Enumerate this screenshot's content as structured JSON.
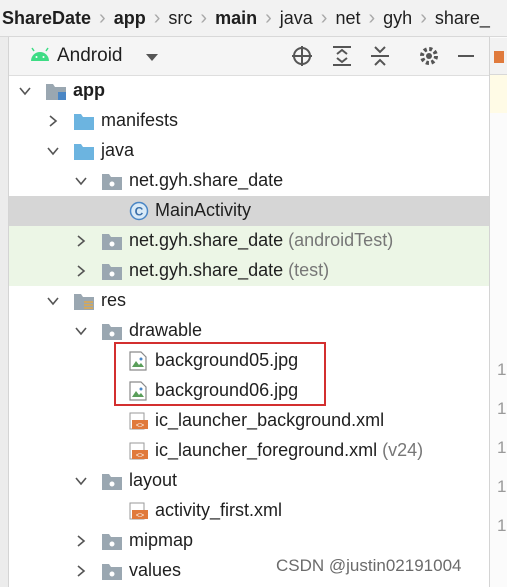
{
  "breadcrumb": {
    "items": [
      "ShareDate",
      "app",
      "src",
      "main",
      "java",
      "net",
      "gyh",
      "share_"
    ]
  },
  "toolbar": {
    "view_label": "Android",
    "dropdown_icon": "triangle-down-icon",
    "icons": [
      "locate-icon",
      "expand-all-icon",
      "collapse-all-icon",
      "gear-icon",
      "minimize-icon"
    ]
  },
  "tree": {
    "app": "app",
    "manifests": "manifests",
    "java": "java",
    "pkg_main": "net.gyh.share_date",
    "main_activity": "MainActivity",
    "pkg_android_test": "net.gyh.share_date",
    "pkg_android_test_suffix": "(androidTest)",
    "pkg_test": "net.gyh.share_date",
    "pkg_test_suffix": "(test)",
    "res": "res",
    "drawable": "drawable",
    "bg05": "background05.jpg",
    "bg06": "background06.jpg",
    "ic_bg": "ic_launcher_background.xml",
    "ic_fg": "ic_launcher_foreground.xml",
    "ic_fg_suffix": "(v24)",
    "layout": "layout",
    "activity_first": "activity_first.xml",
    "mipmap": "mipmap",
    "values": "values"
  },
  "editor": {
    "line_numbers": [
      "1",
      "1",
      "1",
      "1",
      "1"
    ]
  },
  "watermark": "CSDN @justin02191004",
  "colors": {
    "selection": "#d6d6d6",
    "test_bg": "#ecf6e6",
    "highlight_box": "#d32f2f",
    "folder_blue": "#6cb4e0",
    "xml_orange": "#e07a3c"
  }
}
